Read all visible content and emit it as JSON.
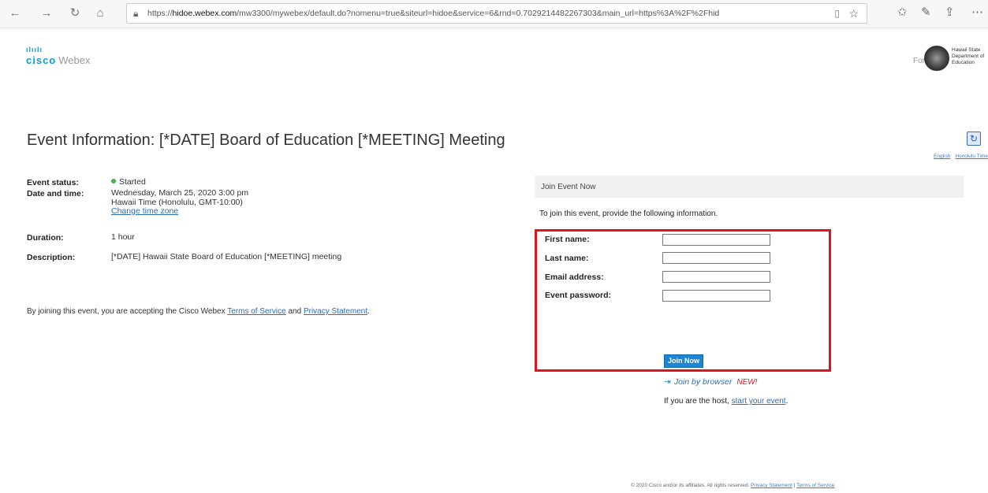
{
  "browser": {
    "url_prefix": "https://",
    "url_host": "hidoe.webex.com",
    "url_path": "/mw3300/mywebex/default.do?nomenu=true&siteurl=hidoe&service=6&rnd=0.7029214482267303&main_url=https%3A%2F%2Fhid"
  },
  "header": {
    "brand": "cisco",
    "product": "Webex",
    "for_label": "For",
    "org_name": "Hawaii State Department of Education"
  },
  "page_title": "Event Information: [*DATE] Board of Education [*MEETING] Meeting",
  "lang_links": [
    "English",
    "Honolulu Time"
  ],
  "details": {
    "status_label": "Event status:",
    "status_value": "Started",
    "date_label": "Date and time:",
    "date_line1": "Wednesday, March 25, 2020 3:00 pm",
    "date_line2": "Hawaii Time (Honolulu, GMT-10:00)",
    "change_tz": "Change time zone",
    "duration_label": "Duration:",
    "duration_value": "1 hour",
    "description_label": "Description:",
    "description_value": "[*DATE] Hawaii State Board of Education [*MEETING] meeting"
  },
  "disclaimer": {
    "prefix": "By joining this event, you are accepting the Cisco Webex",
    "tos": "Terms of Service",
    "and": "and",
    "privacy": "Privacy Statement",
    "suffix": "."
  },
  "join": {
    "header": "Join Event Now",
    "instruction": "To join this event, provide the following information.",
    "fields": {
      "first_name": "First name:",
      "last_name": "Last name:",
      "email": "Email address:",
      "password": "Event password:"
    },
    "values": {
      "first_name": "",
      "last_name": "",
      "email": "",
      "password": ""
    },
    "join_button": "Join Now",
    "browser_link": "Join by browser",
    "new_badge": "NEW!",
    "host_prefix": "If you are the host,",
    "host_link": "start your event",
    "host_suffix": "."
  },
  "footer": {
    "copyright": "© 2020 Cisco and/or its affiliates. All rights reserved.",
    "privacy": "Privacy Statement",
    "separator": "|",
    "terms": "Terms of Service"
  },
  "colors": {
    "highlight_border": "#e0141e",
    "join_button": "#1b85d6",
    "link": "#2a6db8",
    "status_dot": "#4caf50"
  }
}
